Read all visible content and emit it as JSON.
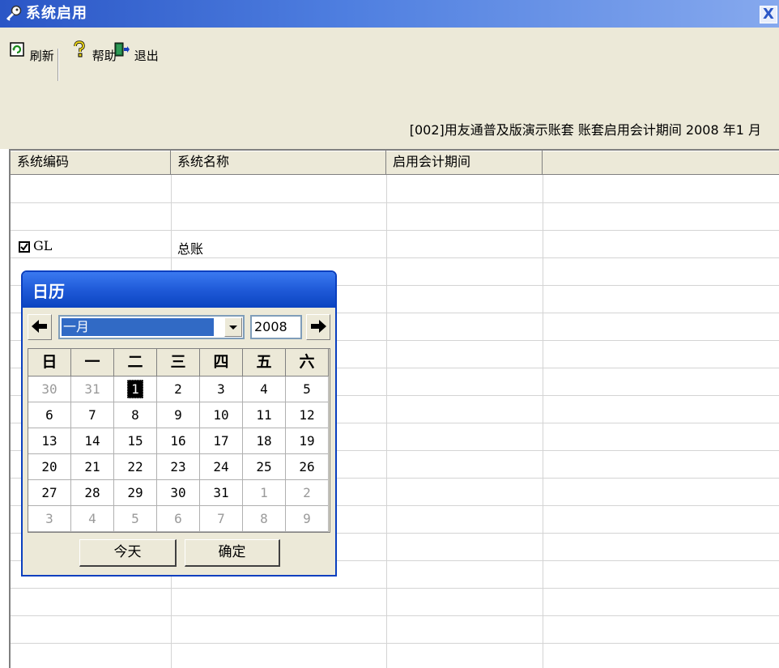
{
  "window": {
    "title": "系统启用",
    "close_glyph": "X"
  },
  "toolbar": {
    "refresh_label": "刷新",
    "help_label": "帮助",
    "exit_label": "退出"
  },
  "info": {
    "text": "[002]用友通普及版演示账套 账套启用会计期间 2008 年1 月"
  },
  "grid": {
    "headers": [
      "系统编码",
      "系统名称",
      "启用会计期间",
      ""
    ],
    "rows": [
      {
        "code": "GL",
        "name": "总账",
        "checked": true
      }
    ]
  },
  "calendar": {
    "title": "日历",
    "month": "一月",
    "year": "2008",
    "weekdays": [
      "日",
      "一",
      "二",
      "三",
      "四",
      "五",
      "六"
    ],
    "weeks": [
      [
        "30",
        "31",
        "1",
        "2",
        "3",
        "4",
        "5"
      ],
      [
        "6",
        "7",
        "8",
        "9",
        "10",
        "11",
        "12"
      ],
      [
        "13",
        "14",
        "15",
        "16",
        "17",
        "18",
        "19"
      ],
      [
        "20",
        "21",
        "22",
        "23",
        "24",
        "25",
        "26"
      ],
      [
        "27",
        "28",
        "29",
        "30",
        "31",
        "1",
        "2"
      ],
      [
        "3",
        "4",
        "5",
        "6",
        "7",
        "8",
        "9"
      ]
    ],
    "selected_day": "1",
    "today_label": "今天",
    "ok_label": "确定"
  }
}
